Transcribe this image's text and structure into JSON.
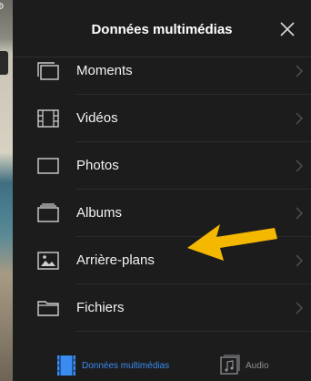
{
  "header": {
    "title": "Données multimédias"
  },
  "items": [
    {
      "label": "Moments",
      "icon": "moments-icon"
    },
    {
      "label": "Vidéos",
      "icon": "film-icon"
    },
    {
      "label": "Photos",
      "icon": "photo-frame-icon"
    },
    {
      "label": "Albums",
      "icon": "album-icon"
    },
    {
      "label": "Arrière-plans",
      "icon": "wallpaper-icon"
    },
    {
      "label": "Fichiers",
      "icon": "folder-icon"
    }
  ],
  "tabs": [
    {
      "label": "Données multimédias",
      "icon": "media-icon",
      "active": true
    },
    {
      "label": "Audio",
      "icon": "music-note-icon",
      "active": false
    }
  ],
  "colors": {
    "accent": "#3b8cf0",
    "annotation_arrow": "#f5b800",
    "background": "#1c1c1d"
  }
}
